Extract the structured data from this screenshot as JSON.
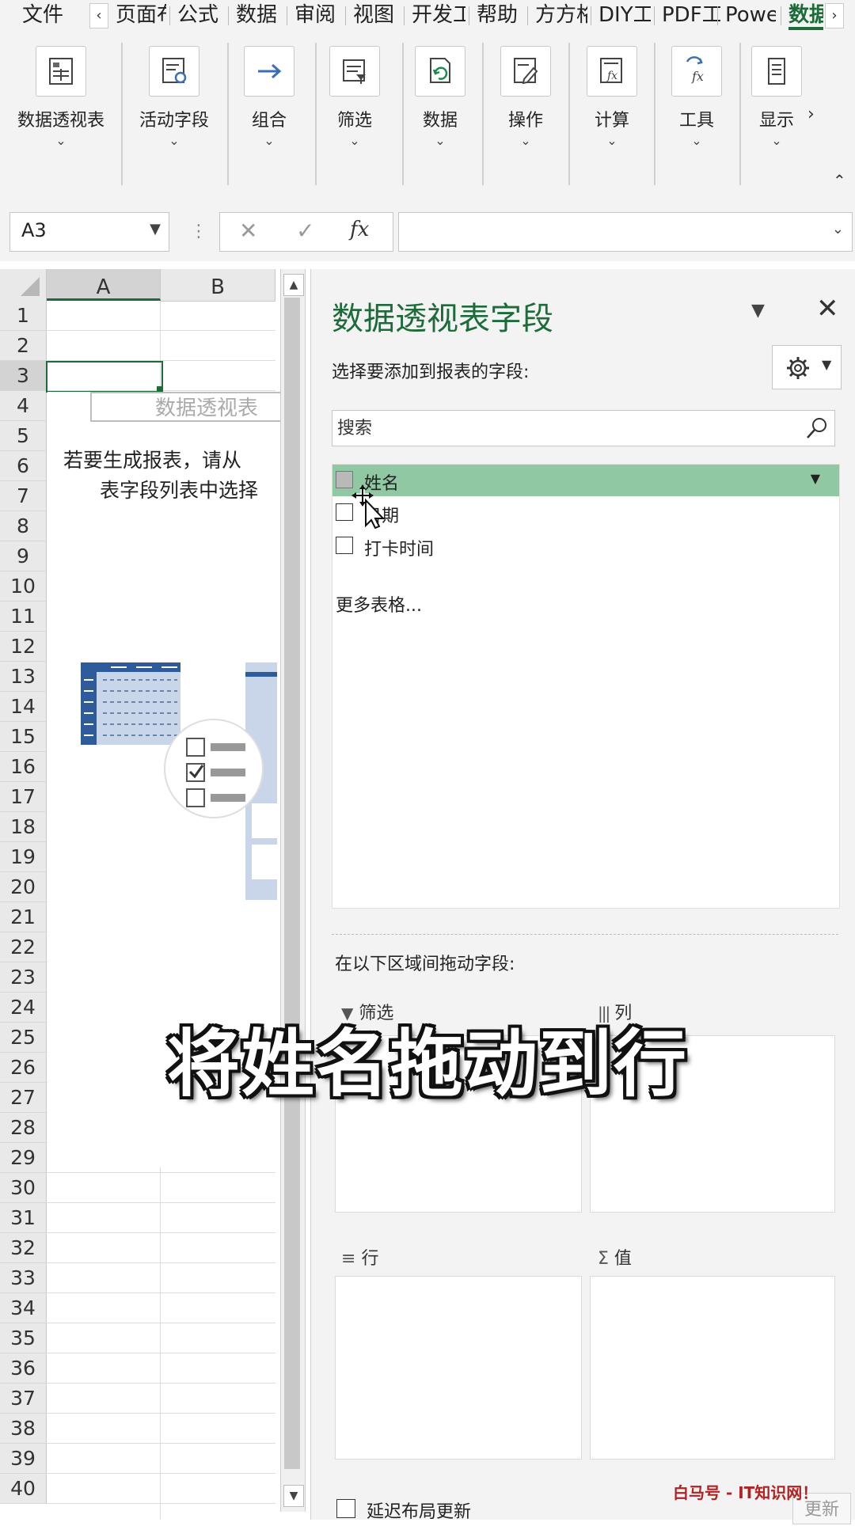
{
  "ribbon_tabs": [
    "文件",
    "页面布",
    "公式",
    "数据",
    "审阅",
    "视图",
    "开发工",
    "帮助",
    "方方格",
    "DIY工",
    "PDF工",
    "Powe",
    "数据"
  ],
  "ribbon_groups": [
    "数据透视表",
    "活动字段",
    "组合",
    "筛选",
    "数据",
    "操作",
    "计算",
    "工具",
    "显示"
  ],
  "name_box": "A3",
  "formula_bar": {
    "cancel": "✕",
    "confirm": "✓",
    "fx": "fx",
    "value": ""
  },
  "sheet": {
    "columns": [
      "A",
      "B"
    ],
    "rows": [
      "1",
      "2",
      "3",
      "4",
      "5",
      "6",
      "7",
      "8",
      "9",
      "10",
      "11",
      "12",
      "13",
      "14",
      "15",
      "16",
      "17",
      "18",
      "19",
      "20",
      "21",
      "22",
      "23",
      "24",
      "25",
      "26",
      "27",
      "28",
      "29",
      "30",
      "31",
      "32",
      "33",
      "34",
      "35",
      "36",
      "37",
      "38",
      "39",
      "40"
    ],
    "selected_row": "3",
    "pivot_placeholder_title": "数据透视表",
    "pivot_message_line1": "若要生成报表，请从",
    "pivot_message_line2": "表字段列表中选择"
  },
  "pane": {
    "title": "数据透视表字段",
    "subtitle": "选择要添加到报表的字段:",
    "search_placeholder": "搜索",
    "fields": [
      {
        "label": "姓名",
        "checked": false,
        "highlighted": true
      },
      {
        "label": "日期",
        "checked": false,
        "highlighted": false
      },
      {
        "label": "打卡时间",
        "checked": false,
        "highlighted": false
      }
    ],
    "more_tables": "更多表格...",
    "drag_hint": "在以下区域间拖动字段:",
    "areas": {
      "filter": "筛选",
      "columns": "列",
      "rows": "行",
      "values": "值"
    },
    "defer_update": "延迟布局更新",
    "update_button": "更新"
  },
  "overlay": {
    "subtitle": "将姓名拖动到行",
    "watermark": "白马号 - IT知识网！"
  },
  "colors": {
    "accent": "#1e6b3a",
    "highlight": "#8fc8a2"
  }
}
